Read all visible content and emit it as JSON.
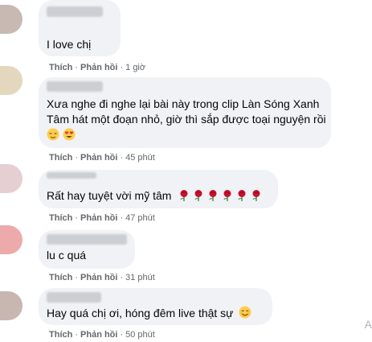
{
  "comments": [
    {
      "avatar_color": "#c9b9b3",
      "text_lines": [
        "I love chị"
      ],
      "like_label": "Thích",
      "reply_label": "Phản hồi",
      "time": "1 giờ",
      "emojis": []
    },
    {
      "avatar_color": "#e3d7be",
      "text_lines": [
        "Xưa nghe đi nghe lại bài này trong clip Làn Sóng Xanh",
        "Tâm hát một đoạn nhỏ, giờ thì sắp được toại nguyện rồi"
      ],
      "like_label": "Thích",
      "reply_label": "Phản hồi",
      "time": "45 phút",
      "emojis": [
        "relieved-face",
        "heart-eyes-face"
      ]
    },
    {
      "avatar_color": "#e6cfd3",
      "text_lines": [
        "Rất hay tuyệt vời mỹ tâm"
      ],
      "like_label": "Thích",
      "reply_label": "Phản hồi",
      "time": "47 phút",
      "emojis": [
        "rose",
        "rose",
        "rose",
        "rose",
        "rose",
        "rose"
      ]
    },
    {
      "avatar_color": "#ecaaaa",
      "text_lines": [
        "lu c quá"
      ],
      "like_label": "Thích",
      "reply_label": "Phản hồi",
      "time": "31 phút",
      "emojis": []
    },
    {
      "avatar_color": "#c8b6b1",
      "text_lines": [
        "Hay quá chị ơi, hóng đêm live thật sự"
      ],
      "like_label": "Thích",
      "reply_label": "Phản hồi",
      "time": "50 phút",
      "emojis": [
        "smiling-face"
      ]
    }
  ],
  "watermark": "A"
}
